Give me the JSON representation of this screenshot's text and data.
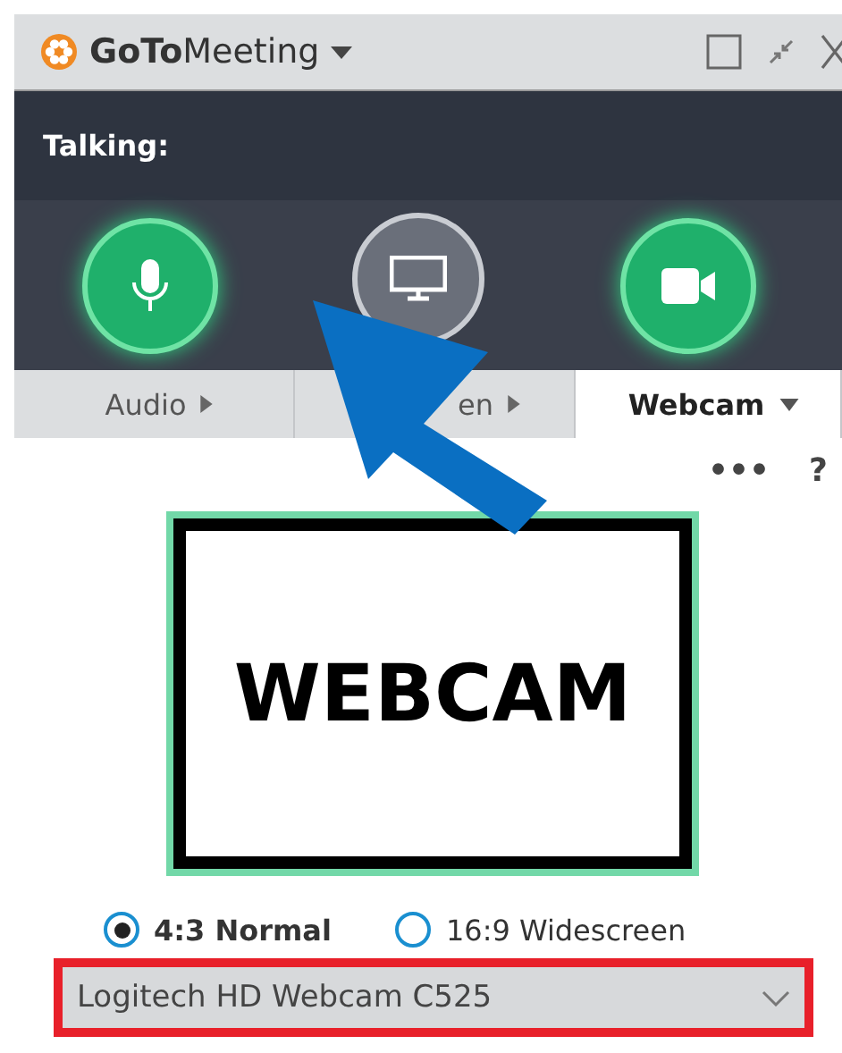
{
  "window": {
    "title_bold": "GoTo",
    "title_rest": "Meeting"
  },
  "talking": {
    "label": "Talking:"
  },
  "controls": [
    {
      "kind": "mic",
      "on": true
    },
    {
      "kind": "screen",
      "on": false
    },
    {
      "kind": "camera",
      "on": true
    }
  ],
  "tabs": [
    {
      "label": "Audio",
      "selected": false
    },
    {
      "label": "en",
      "selected": false
    },
    {
      "label": "Webcam",
      "selected": true
    }
  ],
  "toolbar": {
    "more": "•••",
    "help": "?"
  },
  "preview": {
    "text": "WEBCAM"
  },
  "aspect": [
    {
      "label": "4:3 Normal",
      "selected": true
    },
    {
      "label": "16:9 Widescreen",
      "selected": false
    }
  ],
  "device": {
    "value": "Logitech HD Webcam C525"
  }
}
